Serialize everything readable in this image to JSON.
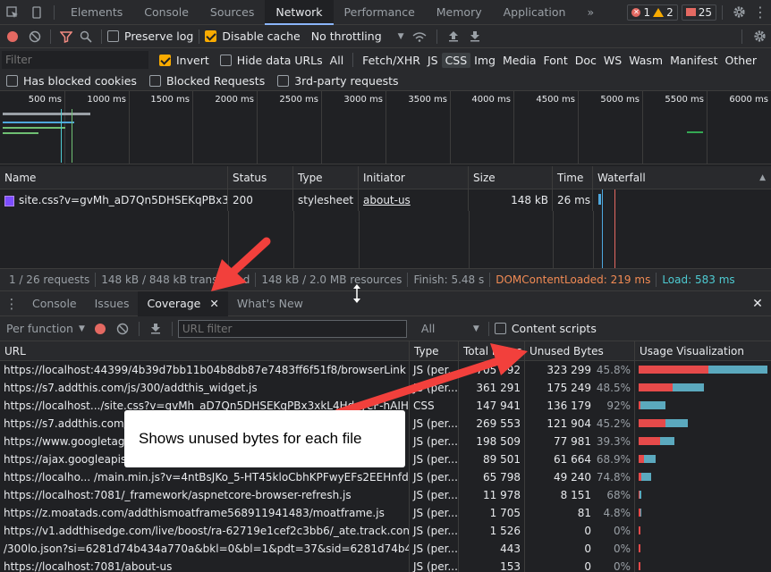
{
  "tabs": [
    "Elements",
    "Console",
    "Sources",
    "Network",
    "Performance",
    "Memory",
    "Application"
  ],
  "tabs_more": "»",
  "badges": {
    "errors": "1",
    "warnings": "2",
    "issues": "25"
  },
  "toolbar": {
    "preserve_log": "Preserve log",
    "disable_cache": "Disable cache",
    "throttling": "No throttling"
  },
  "filter": {
    "placeholder": "Filter",
    "invert": "Invert",
    "hide_data_urls": "Hide data URLs",
    "types": [
      "All",
      "Fetch/XHR",
      "JS",
      "CSS",
      "Img",
      "Media",
      "Font",
      "Doc",
      "WS",
      "Wasm",
      "Manifest",
      "Other"
    ],
    "selected_type": "CSS",
    "blocked_cookies": "Has blocked cookies",
    "blocked_requests": "Blocked Requests",
    "third_party": "3rd-party requests"
  },
  "overview_ticks": [
    "500 ms",
    "1000 ms",
    "1500 ms",
    "2000 ms",
    "2500 ms",
    "3000 ms",
    "3500 ms",
    "4000 ms",
    "4500 ms",
    "5000 ms",
    "5500 ms",
    "6000 ms"
  ],
  "request_columns": [
    "Name",
    "Status",
    "Type",
    "Initiator",
    "Size",
    "Time",
    "Waterfall"
  ],
  "request": {
    "name": "site.css?v=gvMh_aD7Qn5DHSEKqPBx3xk...",
    "status": "200",
    "type": "stylesheet",
    "initiator": "about-us",
    "size": "148 kB",
    "time": "26 ms"
  },
  "statusbar": {
    "requests": "1 / 26 requests",
    "transferred": "148 kB / 848 kB transferred",
    "resources": "148 kB / 2.0 MB resources",
    "finish": "Finish: 5.48 s",
    "dcl": "DOMContentLoaded: 219 ms",
    "load": "Load: 583 ms",
    "colors": {
      "dcl": "#f28b54",
      "load": "#4ecbd2"
    }
  },
  "drawer_tabs": {
    "console": "Console",
    "issues": "Issues",
    "coverage": "Coverage",
    "whats_new": "What's New"
  },
  "coverage_toolbar": {
    "per_function": "Per function",
    "url_filter_placeholder": "URL filter",
    "type_filter": "All",
    "content_scripts": "Content scripts"
  },
  "coverage_columns": [
    "URL",
    "Type",
    "Total Bytes",
    "Unused Bytes",
    "Usage Visualization"
  ],
  "coverage_rows": [
    {
      "url": "https://localhost:44399/4b39d7bb11b04b8db87e7483ff6f51f8/browserLink",
      "type": "JS (per...",
      "total": "705 792",
      "unused": "323 299",
      "pct": "45.8%",
      "used_frac": 0.54,
      "unused_frac": 0.46,
      "width_frac": 1.0
    },
    {
      "url": "https://s7.addthis.com/js/300/addthis_widget.js",
      "type": "JS (per...",
      "total": "361 291",
      "unused": "175 249",
      "pct": "48.5%",
      "used_frac": 0.515,
      "unused_frac": 0.485,
      "width_frac": 0.51
    },
    {
      "url": "https://localhost.../site.css?v=gvMh_aD7Qn5DHSEKqPBx3xkL4HdcyeF-hAIHzheEeBw",
      "type": "CSS",
      "total": "147 941",
      "unused": "136 179",
      "pct": "92%",
      "used_frac": 0.08,
      "unused_frac": 0.92,
      "width_frac": 0.21
    },
    {
      "url": "https://s7.addthis.com/static/...",
      "type": "JS (per...",
      "total": "269 553",
      "unused": "121 904",
      "pct": "45.2%",
      "used_frac": 0.548,
      "unused_frac": 0.452,
      "width_frac": 0.38
    },
    {
      "url": "https://www.googletagmanager.com/...",
      "type": "JS (per...",
      "total": "198 509",
      "unused": "77 981",
      "pct": "39.3%",
      "used_frac": 0.607,
      "unused_frac": 0.393,
      "width_frac": 0.28
    },
    {
      "url": "https://ajax.googleapis.com/...",
      "type": "JS (per...",
      "total": "89 501",
      "unused": "61 664",
      "pct": "68.9%",
      "used_frac": 0.311,
      "unused_frac": 0.689,
      "width_frac": 0.13
    },
    {
      "url": "https://localho... /main.min.js?v=4ntBsJKo_5-HT45kloCbhKPFwyEFs2EEHnfdamWI-EU",
      "type": "JS (per...",
      "total": "65 798",
      "unused": "49 240",
      "pct": "74.8%",
      "used_frac": 0.252,
      "unused_frac": 0.748,
      "width_frac": 0.095
    },
    {
      "url": "https://localhost:7081/_framework/aspnetcore-browser-refresh.js",
      "type": "JS (per...",
      "total": "11 978",
      "unused": "8 151",
      "pct": "68%",
      "used_frac": 0.32,
      "unused_frac": 0.68,
      "width_frac": 0.02
    },
    {
      "url": "https://z.moatads.com/addthismoatframe568911941483/moatframe.js",
      "type": "JS (per...",
      "total": "1 705",
      "unused": "81",
      "pct": "4.8%",
      "used_frac": 0.95,
      "unused_frac": 0.05,
      "width_frac": 0.012
    },
    {
      "url": "https://v1.addthisedge.com/live/boost/ra-62719e1cef2c3bb6/_ate.track.config_resp",
      "type": "JS (per...",
      "total": "1 526",
      "unused": "0",
      "pct": "0%",
      "used_frac": 1.0,
      "unused_frac": 0.0,
      "width_frac": 0.01
    },
    {
      "url": "/300lo.json?si=6281d74b434a770a&bkl=0&bl=1&pdt=37&sid=6281d74b434a770a&",
      "type": "JS (per...",
      "total": "443",
      "unused": "0",
      "pct": "0%",
      "used_frac": 1.0,
      "unused_frac": 0.0,
      "width_frac": 0.008
    },
    {
      "url": "https://localhost:7081/about-us",
      "type": "JS (per...",
      "total": "153",
      "unused": "0",
      "pct": "0%",
      "used_frac": 1.0,
      "unused_frac": 0.0,
      "width_frac": 0.008
    }
  ],
  "bar_colors": {
    "used": "#e64a4a",
    "unused": "#5ba9be"
  },
  "callout": "Shows unused bytes for each file",
  "annotation_color": "#f2403c"
}
